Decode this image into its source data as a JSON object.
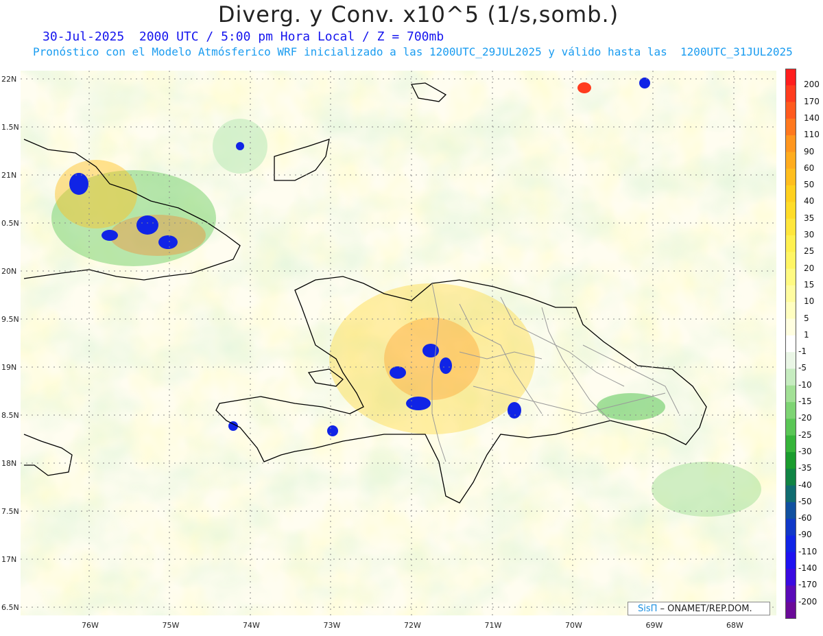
{
  "header": {
    "title": "Diverg. y Conv. x10^5 (1/s,somb.)",
    "subtitle": "30-Jul-2025  2000 UTC / 5:00 pm Hora Local / Z = 700mb",
    "forecast_note": "Pronóstico con el Modelo Atmósferico WRF inicializado a las 1200UTC_29JUL2025 y válido hasta las  1200UTC_31JUL2025"
  },
  "axes": {
    "lat_labels": [
      "22N",
      "1.5N",
      "21N",
      "0.5N",
      "20N",
      "9.5N",
      "19N",
      "8.5N",
      "18N",
      "7.5N",
      "17N",
      "6.5N"
    ],
    "lon_labels": [
      "76W",
      "75W",
      "74W",
      "73W",
      "72W",
      "71W",
      "70W",
      "69W",
      "68W"
    ]
  },
  "colorbar": {
    "labels": [
      "200",
      "170",
      "140",
      "110",
      "90",
      "60",
      "50",
      "40",
      "35",
      "30",
      "25",
      "20",
      "15",
      "10",
      "5",
      "1",
      "-1",
      "-5",
      "-10",
      "-15",
      "-20",
      "-25",
      "-30",
      "-35",
      "-40",
      "-50",
      "-60",
      "-90",
      "-110",
      "-140",
      "-170",
      "-200"
    ],
    "colors": [
      "#ff1e1e",
      "#ff3c1e",
      "#ff5a1e",
      "#ff781e",
      "#ff961e",
      "#ffac1e",
      "#ffbe1e",
      "#ffd01e",
      "#ffdc28",
      "#ffe63c",
      "#fff050",
      "#fff564",
      "#fffa82",
      "#fffca0",
      "#fffec0",
      "#fffee0",
      "#ffffff",
      "#eaf6e6",
      "#c6ecc0",
      "#a2e096",
      "#7ed474",
      "#5ac656",
      "#36b43a",
      "#1a9c2e",
      "#108444",
      "#106c70",
      "#1050a0",
      "#1038c8",
      "#1024e6",
      "#1e12f0",
      "#3a0ae0",
      "#5a0ab8",
      "#6a0a98"
    ]
  },
  "credit": {
    "brand": "SisΠ",
    "org": " – ONAMET/REP.DOM."
  }
}
